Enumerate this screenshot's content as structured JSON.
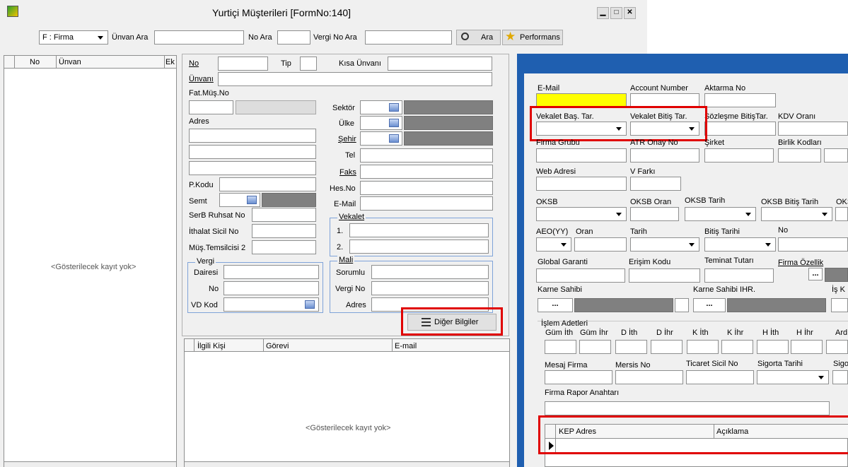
{
  "window": {
    "title": "Yurtiçi Müşterileri [FormNo:140]",
    "minimize": "▁",
    "maximize": "□",
    "close": "✕"
  },
  "toolbar": {
    "firma_select": "F : Firma",
    "unvan_ara": "Ünvan Ara",
    "no_ara": "No Ara",
    "vergi_no_ara": "Vergi No Ara",
    "ara": "Ara",
    "performans": "Performans"
  },
  "left_grid": {
    "col_no": "No",
    "col_unvan": "Ünvan",
    "col_ek": "Ek",
    "empty": "<Gösterilecek kayıt yok>"
  },
  "form": {
    "no": "No",
    "tip": "Tip",
    "kisa_unvan": "Kısa Ünvanı",
    "unvan": "Ünvanı",
    "fat_mus_no": "Fat.Müş.No",
    "sektor": "Sektör",
    "ulke": "Ülke",
    "sehir": "Şehir",
    "tel": "Tel",
    "faks": "Faks",
    "hes_no": "Hes.No",
    "email": "E-Mail",
    "adres": "Adres",
    "pkodu": "P.Kodu",
    "semt": "Semt",
    "serb_ruhsat": "SerB Ruhsat No",
    "ithalat_sicil": "İthalat Sicil No",
    "mus_temsilci": "Müş.Temsilcisi 2",
    "vekalet_title": "Vekalet",
    "vekalet_1": "1.",
    "vekalet_2": "2.",
    "vergi_title": "Vergi",
    "vergi_dairesi": "Dairesi",
    "vergi_no": "No",
    "vd_kod": "VD Kod",
    "mali_title": "Mali",
    "mali_sorumlu": "Sorumlu",
    "mali_vergi_no": "Vergi No",
    "mali_adres": "Adres",
    "diger_bilgiler": "Diğer Bilgiler"
  },
  "contacts": {
    "col_ilgili": "İlgili Kişi",
    "col_gorevi": "Görevi",
    "col_email": "E-mail",
    "empty": "<Gösterilecek kayıt yok>"
  },
  "right": {
    "email": "E-Mail",
    "account_number": "Account Number",
    "aktarma_no": "Aktarma No",
    "vekalet_bas": "Vekalet Baş. Tar.",
    "vekalet_bitis": "Vekalet Bitiş Tar.",
    "sozlesme_bitis": "Sözleşme BitişTar.",
    "kdv_orani": "KDV Oranı",
    "firma_grubu": "Firma Grubu",
    "atr_onay": "ATR Onay No",
    "sirket": "Şirket",
    "birlik_kodlari": "Birlik Kodları",
    "web_adresi": "Web Adresi",
    "v_farki": "V Farkı",
    "oksb": "OKSB",
    "oksb_oran": "OKSB Oran",
    "oksb_tarih": "OKSB Tarih",
    "oksb_bitis": "OKSB Bitiş Tarih",
    "oks": "OKS",
    "aeo": "AEO(YY)",
    "oran": "Oran",
    "tarih": "Tarih",
    "bitis_tarihi": "Bitiş Tarihi",
    "no": "No",
    "global_garanti": "Global Garanti",
    "erisim_kodu": "Erişim Kodu",
    "teminat_tutari": "Teminat Tutarı",
    "firma_ozellik": "Firma Özellik",
    "karne_sahibi": "Karne Sahibi",
    "karne_sahibi_ihr": "Karne Sahibi IHR.",
    "is_k": "İş K",
    "islem_adetleri": "İşlem Adetleri",
    "gum_ith": "Güm İth",
    "gum_ihr": "Güm İhr",
    "d_ith": "D İth",
    "d_ihr": "D İhr",
    "k_ith": "K İth",
    "k_ihr": "K İhr",
    "h_ith": "H İth",
    "h_ihr": "H İhr",
    "ard": "Ard",
    "mesaj_firma": "Mesaj Firma",
    "mersis_no": "Mersis No",
    "ticaret_sicil": "Ticaret Sicil No",
    "sigorta_tarihi": "Sigorta Tarihi",
    "sigo": "Sigo",
    "firma_rapor": "Firma Rapor Anahtarı",
    "kep_adres": "KEP Adres",
    "aciklama": "Açıklama",
    "ellipsis": "..."
  },
  "colors": {
    "highlight": "#e00000",
    "email_bg": "#ffff00"
  }
}
